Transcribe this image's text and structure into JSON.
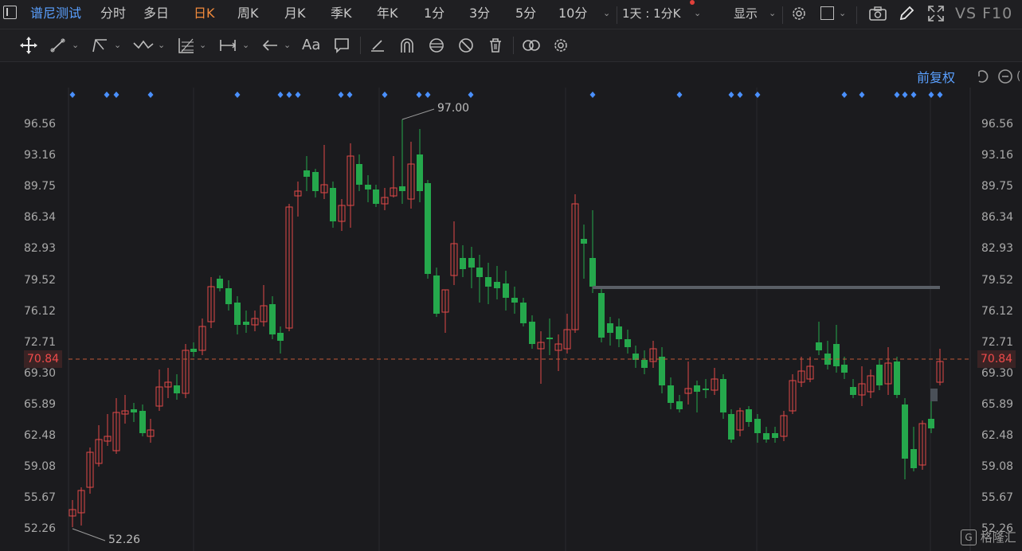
{
  "topbar": {
    "stock_name": "谱尼测试",
    "periods": [
      "分时",
      "多日",
      "日K",
      "周K",
      "月K",
      "季K",
      "年K",
      "1分",
      "3分",
      "5分",
      "10分"
    ],
    "active_period": "日K",
    "multi_period": "1天 : 1分K",
    "display_label": "显示",
    "right_label": "VS F10"
  },
  "chart": {
    "adjust_label": "前复权",
    "y_ticks": [
      "96.56",
      "93.16",
      "89.75",
      "86.34",
      "82.93",
      "79.52",
      "76.12",
      "72.71",
      "69.30",
      "65.89",
      "62.48",
      "59.08",
      "55.67",
      "52.26"
    ],
    "current_price": "70.84",
    "high_annotation": "97.00",
    "low_annotation": "52.26",
    "colors": {
      "up": "#e04848",
      "down": "#25a84c",
      "accent": "#f08a3c",
      "link": "#5aa0ff"
    }
  },
  "watermark": "格隆汇"
}
